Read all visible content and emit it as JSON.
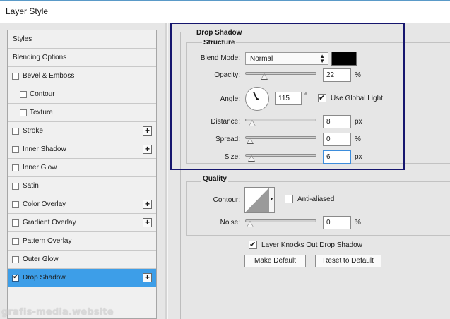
{
  "window": {
    "title": "Layer Style"
  },
  "sidebar": {
    "items": [
      {
        "label": "Styles",
        "checkbox": false,
        "plus": false,
        "indent": false,
        "selected": false
      },
      {
        "label": "Blending Options",
        "checkbox": false,
        "plus": false,
        "indent": false,
        "selected": false
      },
      {
        "label": "Bevel & Emboss",
        "checkbox": true,
        "plus": false,
        "indent": false,
        "selected": false
      },
      {
        "label": "Contour",
        "checkbox": true,
        "plus": false,
        "indent": true,
        "selected": false
      },
      {
        "label": "Texture",
        "checkbox": true,
        "plus": false,
        "indent": true,
        "selected": false
      },
      {
        "label": "Stroke",
        "checkbox": true,
        "plus": true,
        "indent": false,
        "selected": false
      },
      {
        "label": "Inner Shadow",
        "checkbox": true,
        "plus": true,
        "indent": false,
        "selected": false
      },
      {
        "label": "Inner Glow",
        "checkbox": true,
        "plus": false,
        "indent": false,
        "selected": false
      },
      {
        "label": "Satin",
        "checkbox": true,
        "plus": false,
        "indent": false,
        "selected": false
      },
      {
        "label": "Color Overlay",
        "checkbox": true,
        "plus": true,
        "indent": false,
        "selected": false
      },
      {
        "label": "Gradient Overlay",
        "checkbox": true,
        "plus": true,
        "indent": false,
        "selected": false
      },
      {
        "label": "Pattern Overlay",
        "checkbox": true,
        "plus": false,
        "indent": false,
        "selected": false
      },
      {
        "label": "Outer Glow",
        "checkbox": true,
        "plus": false,
        "indent": false,
        "selected": false
      },
      {
        "label": "Drop Shadow",
        "checkbox": true,
        "plus": true,
        "indent": false,
        "selected": true
      }
    ],
    "plus_symbol": "+"
  },
  "watermark": "grafis-media.website",
  "drop_shadow": {
    "title": "Drop Shadow",
    "structure": {
      "title": "Structure",
      "blend_mode_label": "Blend Mode:",
      "blend_mode_value": "Normal",
      "blend_mode_arrows": "▲▼",
      "shadow_color": "#000000",
      "opacity_label": "Opacity:",
      "opacity_value": "22",
      "opacity_unit": "%",
      "opacity_level": 0.22,
      "angle_label": "Angle:",
      "angle_value": "115",
      "angle_unit": "°",
      "use_global_light_label": "Use Global Light",
      "use_global_light_checked": true,
      "distance_label": "Distance:",
      "distance_value": "8",
      "distance_unit": "px",
      "distance_level": 0.03,
      "spread_label": "Spread:",
      "spread_value": "0",
      "spread_unit": "%",
      "spread_level": 0.0,
      "size_label": "Size:",
      "size_value": "6",
      "size_unit": "px",
      "size_level": 0.02
    },
    "quality": {
      "title": "Quality",
      "contour_label": "Contour:",
      "anti_aliased_label": "Anti-aliased",
      "anti_aliased_checked": false,
      "noise_label": "Noise:",
      "noise_value": "0",
      "noise_unit": "%",
      "noise_level": 0.0
    },
    "knocks_out_label": "Layer Knocks Out Drop Shadow",
    "knocks_out_checked": true,
    "make_default_label": "Make Default",
    "reset_default_label": "Reset to Default"
  },
  "colors": {
    "selected_row": "#3d9ee8",
    "highlight_frame": "#16166e",
    "title_accent": "#5a9ac8"
  }
}
